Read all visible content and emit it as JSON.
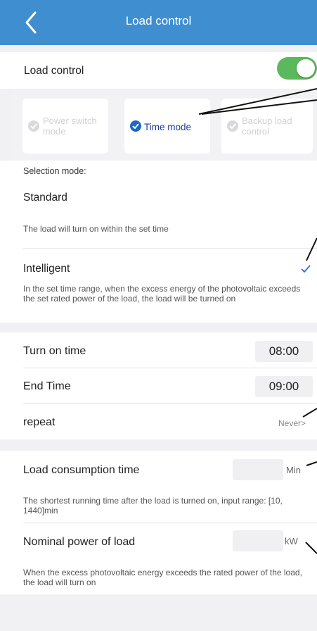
{
  "header": {
    "title": "Load control",
    "back_icon": "chevron-left-icon"
  },
  "load_control": {
    "label": "Load control",
    "enabled": true,
    "accent": "#5cb85c"
  },
  "modes": [
    {
      "label": "Power switch mode",
      "selected": false
    },
    {
      "label": "Time mode",
      "selected": true
    },
    {
      "label": "Backup load control",
      "selected": false
    }
  ],
  "selection": {
    "heading": "Selection mode:",
    "options": [
      {
        "label": "Standard",
        "description": "The load will turn on within the set time",
        "selected": false
      },
      {
        "label": "Intelligent",
        "description": "In the set time range, when the excess energy of the photovoltaic exceeds the set rated power of the load, the load will be turned on",
        "selected": true
      }
    ]
  },
  "schedule": {
    "turn_on_label": "Turn on time",
    "turn_on_value": "08:00",
    "end_label": "End Time",
    "end_value": "09:00",
    "repeat_label": "repeat",
    "repeat_value": "Never>"
  },
  "consumption": {
    "label": "Load consumption time",
    "unit": "Min",
    "value": "",
    "help": "The shortest running time after the load is turned on, input range: [10, 1440]min"
  },
  "power": {
    "label": "Nominal  power of  load",
    "unit": "kW",
    "value": "",
    "help": "When the excess photovoltaic energy exceeds the rated power of the load, the load will turn on"
  },
  "colors": {
    "header": "#3f8ed0",
    "selected_check": "#1e67c4",
    "background": "#f1f1f3"
  }
}
